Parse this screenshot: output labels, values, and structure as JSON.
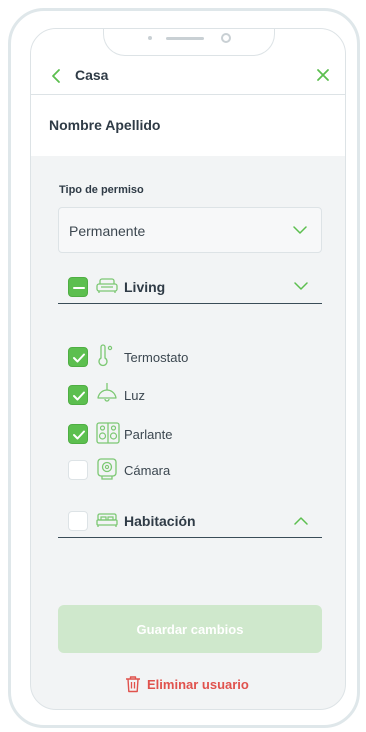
{
  "header": {
    "title": "Casa",
    "user_name": "Nombre Apellido"
  },
  "permission": {
    "label": "Tipo de permiso",
    "selected": "Permanente"
  },
  "groups": [
    {
      "label": "Living",
      "state": "partial",
      "icon": "sofa-icon",
      "expanded": true,
      "items": [
        {
          "label": "Termostato",
          "checked": true,
          "icon": "thermometer-icon"
        },
        {
          "label": "Luz",
          "checked": true,
          "icon": "lamp-icon"
        },
        {
          "label": "Parlante",
          "checked": true,
          "icon": "speaker-icon"
        },
        {
          "label": "Cámara",
          "checked": false,
          "icon": "camera-icon"
        }
      ]
    },
    {
      "label": "Habitación",
      "state": "unchecked",
      "icon": "bed-icon",
      "expanded": false,
      "items": []
    }
  ],
  "actions": {
    "save_label": "Guardar cambios",
    "delete_label": "Eliminar usuario"
  },
  "colors": {
    "accent": "#5cbf4f",
    "accent_disabled": "#cfe8cc",
    "danger": "#e0524d",
    "text": "#2f3b46"
  }
}
